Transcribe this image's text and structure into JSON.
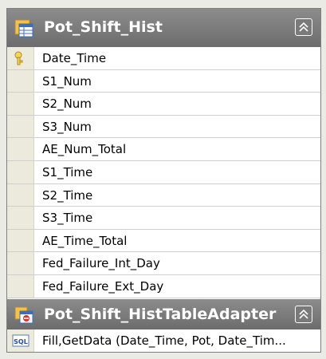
{
  "table": {
    "title": "Pot_Shift_Hist",
    "icon": "table-icon",
    "key_icon": "primary-key-icon",
    "columns": [
      "Date_Time",
      "S1_Num",
      "S2_Num",
      "S3_Num",
      "AE_Num_Total",
      "S1_Time",
      "S2_Time",
      "S3_Time",
      "AE_Time_Total",
      "Fed_Failure_Int_Day",
      "Fed_Failure_Ext_Day"
    ]
  },
  "adapter": {
    "title": "Pot_Shift_HistTableAdapter",
    "icon": "table-adapter-icon",
    "query_icon": "sql-query-icon",
    "query": "Fill,GetData (Date_Time, Pot, Date_Tim..."
  },
  "colors": {
    "title_bar": "#7a7a7a",
    "gutter": "#ebeadd",
    "row_border": "#cfcfcf"
  }
}
